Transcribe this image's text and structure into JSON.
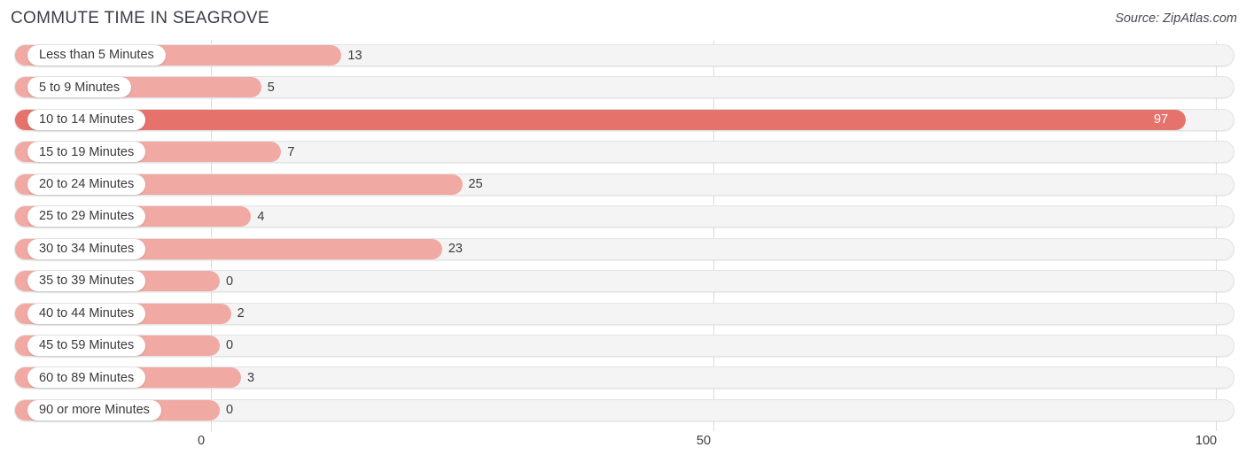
{
  "header": {
    "title": "COMMUTE TIME IN SEAGROVE",
    "source": "Source: ZipAtlas.com"
  },
  "colors": {
    "bar": "#f0a9a3",
    "bar_highlight": "#e5736c",
    "track": "#f4f4f4",
    "gridline": "#dcdcdc",
    "text": "#3a3a3a"
  },
  "chart_data": {
    "type": "bar",
    "orientation": "horizontal",
    "title": "COMMUTE TIME IN SEAGROVE",
    "subtitle": "Source: ZipAtlas.com",
    "xlabel": "",
    "ylabel": "",
    "xlim": [
      0,
      100
    ],
    "xticks": [
      0,
      50,
      100
    ],
    "xtick_labels": [
      "0",
      "50",
      "100"
    ],
    "grid": true,
    "legend": false,
    "categories": [
      "Less than 5 Minutes",
      "5 to 9 Minutes",
      "10 to 14 Minutes",
      "15 to 19 Minutes",
      "20 to 24 Minutes",
      "25 to 29 Minutes",
      "30 to 34 Minutes",
      "35 to 39 Minutes",
      "40 to 44 Minutes",
      "45 to 59 Minutes",
      "60 to 89 Minutes",
      "90 or more Minutes"
    ],
    "values": [
      13,
      5,
      97,
      7,
      25,
      4,
      23,
      0,
      2,
      0,
      3,
      0
    ],
    "value_labels": [
      "13",
      "5",
      "97",
      "7",
      "25",
      "4",
      "23",
      "0",
      "2",
      "0",
      "3",
      "0"
    ],
    "highlight_index": 2
  }
}
